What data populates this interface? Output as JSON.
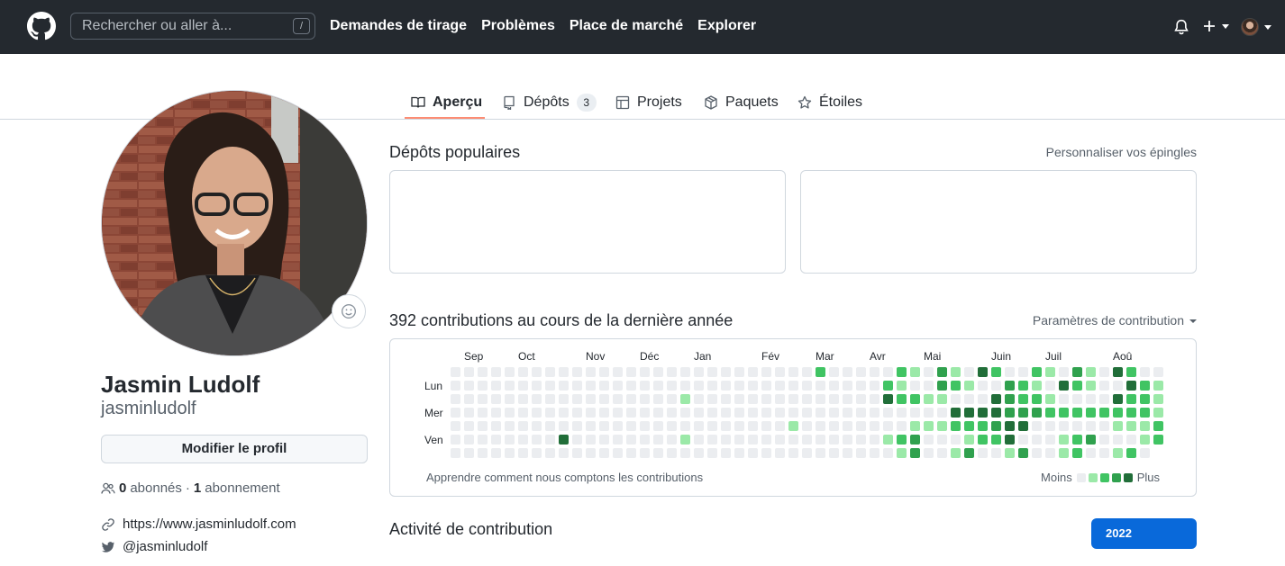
{
  "header": {
    "search_placeholder": "Rechercher ou aller à...",
    "search_shortcut": "/",
    "nav": [
      "Demandes de tirage",
      "Problèmes",
      "Place de marché",
      "Explorer"
    ]
  },
  "tabs": {
    "overview": "Aperçu",
    "repositories": "Dépôts",
    "repositories_count": "3",
    "projects": "Projets",
    "packages": "Paquets",
    "stars": "Étoiles"
  },
  "profile": {
    "name": "Jasmin Ludolf",
    "username": "jasminludolf",
    "edit_button": "Modifier le profil",
    "followers_count": "0",
    "followers_label": "abonnés",
    "separator": "·",
    "following_count": "1",
    "following_label": "abonnement",
    "website": "https://www.jasminludolf.com",
    "twitter": "@jasminludolf"
  },
  "pinned": {
    "title": "Dépôts populaires",
    "customize_link": "Personnaliser vos épingles"
  },
  "contributions": {
    "title": "392 contributions au cours de la dernière année",
    "settings_label": "Paramètres de contribution",
    "months": [
      "Sep",
      "Oct",
      "Nov",
      "Déc",
      "Jan",
      "Fév",
      "Mar",
      "Avr",
      "Mai",
      "Juin",
      "Juil",
      "Aoû"
    ],
    "day_labels": [
      "Lun",
      "Mer",
      "Ven"
    ],
    "learn_link": "Apprendre comment nous comptons les contributions",
    "legend_less": "Moins",
    "legend_more": "Plus",
    "colors": [
      "#ebedf0",
      "#9be9a8",
      "#40c463",
      "#30a14e",
      "#216e39"
    ]
  },
  "activity": {
    "title": "Activité de contribution",
    "year": "2022"
  }
}
